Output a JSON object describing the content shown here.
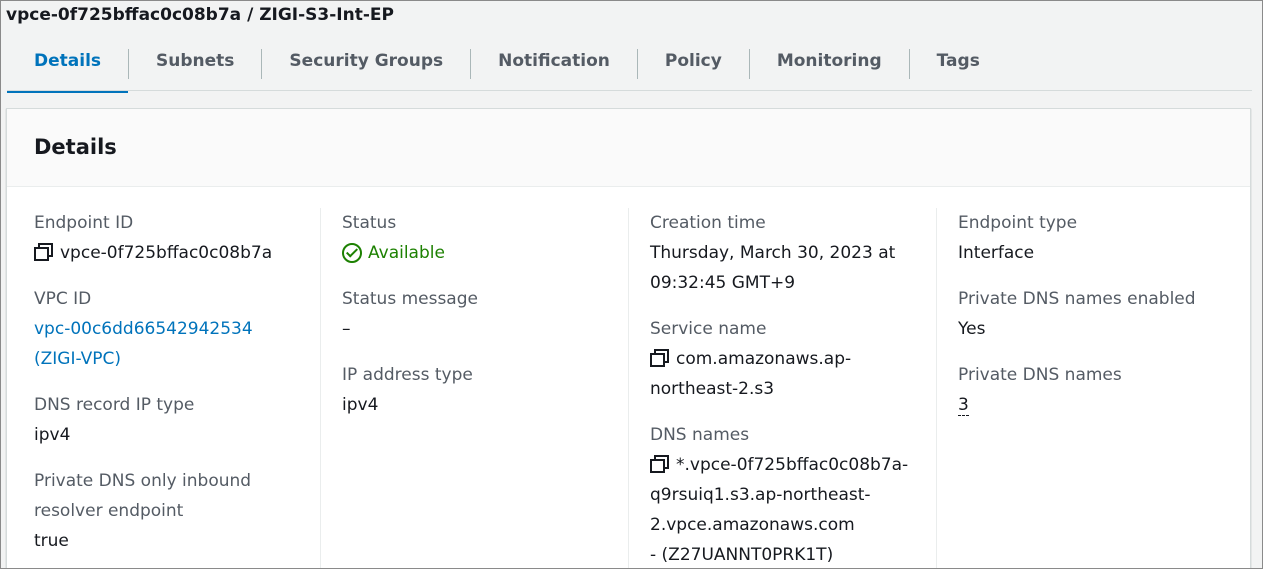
{
  "header": {
    "title": "vpce-0f725bffac0c08b7a / ZIGI-S3-Int-EP"
  },
  "tabs": [
    {
      "label": "Details"
    },
    {
      "label": "Subnets"
    },
    {
      "label": "Security Groups"
    },
    {
      "label": "Notification"
    },
    {
      "label": "Policy"
    },
    {
      "label": "Monitoring"
    },
    {
      "label": "Tags"
    }
  ],
  "panel": {
    "title": "Details"
  },
  "col1": {
    "endpoint_id_label": "Endpoint ID",
    "endpoint_id": "vpce-0f725bffac0c08b7a",
    "vpc_id_label": "VPC ID",
    "vpc_id_line1": "vpc-00c6dd66542942534",
    "vpc_id_line2": "(ZIGI-VPC)",
    "dns_record_label": "DNS record IP type",
    "dns_record": "ipv4",
    "private_dns_inbound_label_line1": "Private DNS only inbound",
    "private_dns_inbound_label_line2": "resolver endpoint",
    "private_dns_inbound": "true"
  },
  "col2": {
    "status_label": "Status",
    "status": "Available",
    "status_message_label": "Status message",
    "status_message": "–",
    "ip_address_type_label": "IP address type",
    "ip_address_type": "ipv4"
  },
  "col3": {
    "creation_time_label": "Creation time",
    "creation_time_line1": "Thursday, March 30, 2023 at",
    "creation_time_line2": "09:32:45 GMT+9",
    "service_name_label": "Service name",
    "service_name_line1": "com.amazonaws.ap-",
    "service_name_line2": "northeast-2.s3",
    "dns_names_label": "DNS names",
    "dns_names_line1": "*.vpce-0f725bffac0c08b7a-",
    "dns_names_line2": "q9rsuiq1.s3.ap-northeast-",
    "dns_names_line3": "2.vpce.amazonaws.com",
    "dns_names_line4": "- (Z27UANNT0PRK1T)"
  },
  "col4": {
    "endpoint_type_label": "Endpoint type",
    "endpoint_type": "Interface",
    "private_dns_enabled_label": "Private DNS names enabled",
    "private_dns_enabled": "Yes",
    "private_dns_names_label": "Private DNS names",
    "private_dns_names": "3"
  },
  "colors": {
    "accent": "#0073bb",
    "success": "#1d8102",
    "text": "#16191f",
    "label": "#545b64"
  }
}
